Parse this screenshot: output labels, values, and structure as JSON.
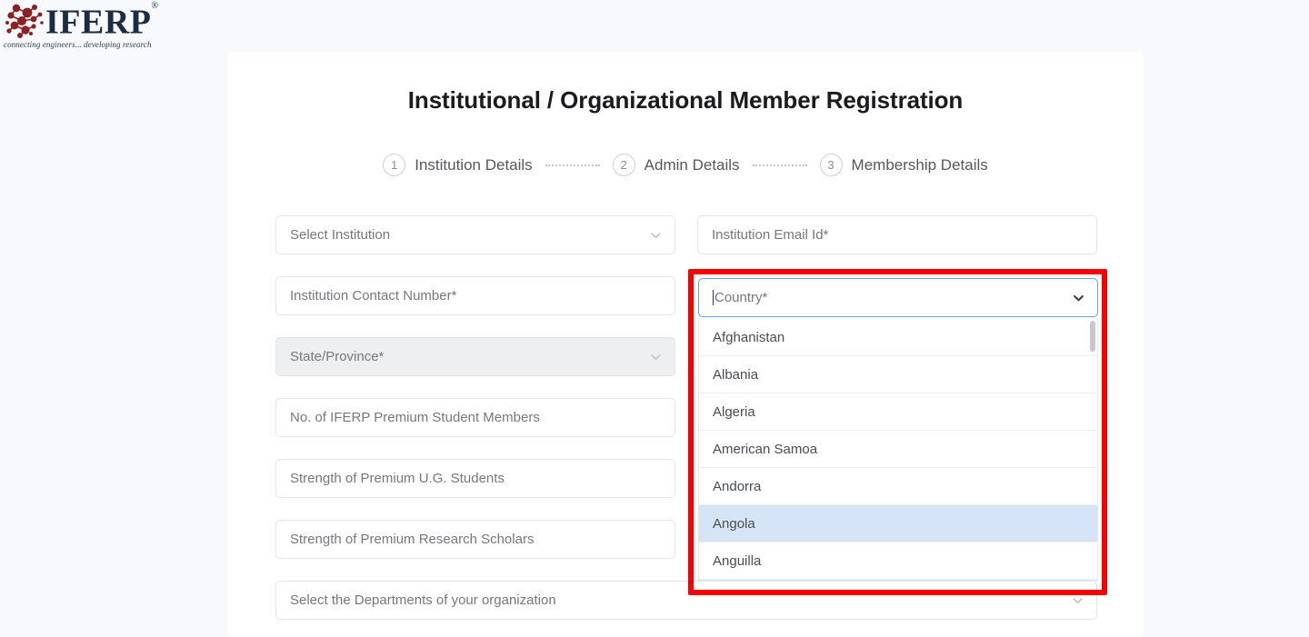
{
  "brand": {
    "mark_icon": "molecule-network-icon",
    "name": "IFERP",
    "registered": "®",
    "tagline_part1": "connecting engineers...",
    "tagline_part2": "developing research",
    "color": "#1e2b44",
    "mark_color": "#8c2025"
  },
  "card": {
    "title": "Institutional / Organizational Member Registration"
  },
  "stepper": {
    "steps": [
      {
        "number": "1",
        "label": "Institution Details"
      },
      {
        "number": "2",
        "label": "Admin Details"
      },
      {
        "number": "3",
        "label": "Membership Details"
      }
    ]
  },
  "form": {
    "fields": [
      {
        "id": "select-institution",
        "placeholder": "Select Institution",
        "type": "select",
        "disabled": false
      },
      {
        "id": "institution-email",
        "placeholder": "Institution Email Id*",
        "type": "text",
        "disabled": false
      },
      {
        "id": "institution-contact",
        "placeholder": "Institution Contact Number*",
        "type": "text",
        "disabled": false
      },
      {
        "id": "country",
        "placeholder": "Country*",
        "type": "select",
        "disabled": false
      },
      {
        "id": "state-province",
        "placeholder": "State/Province*",
        "type": "select",
        "disabled": true
      },
      {
        "id": "premium-student-members",
        "placeholder": "No. of IFERP Premium Student Members",
        "type": "text",
        "disabled": false
      },
      {
        "id": "premium-ug-students",
        "placeholder": "Strength of Premium U.G. Students",
        "type": "text",
        "disabled": false
      },
      {
        "id": "premium-research",
        "placeholder": "Strength of Premium Research Scholars",
        "type": "text",
        "disabled": false
      },
      {
        "id": "departments",
        "placeholder": "Select the Departments of your organization",
        "type": "select",
        "disabled": false
      }
    ]
  },
  "country_dropdown": {
    "open": true,
    "focused_field_placeholder": "Country*",
    "highlighted_option": "Angola",
    "options": [
      "Afghanistan",
      "Albania",
      "Algeria",
      "American Samoa",
      "Andorra",
      "Angola",
      "Anguilla"
    ]
  },
  "annotation": {
    "type": "highlight-rectangle",
    "color": "#fb0000"
  },
  "colors": {
    "page_background": "#f8f9fd",
    "card_background": "#ffffff",
    "focus_border": "#6c9fe8",
    "option_highlight": "#d6e4f7",
    "placeholder_text": "#76787d"
  }
}
